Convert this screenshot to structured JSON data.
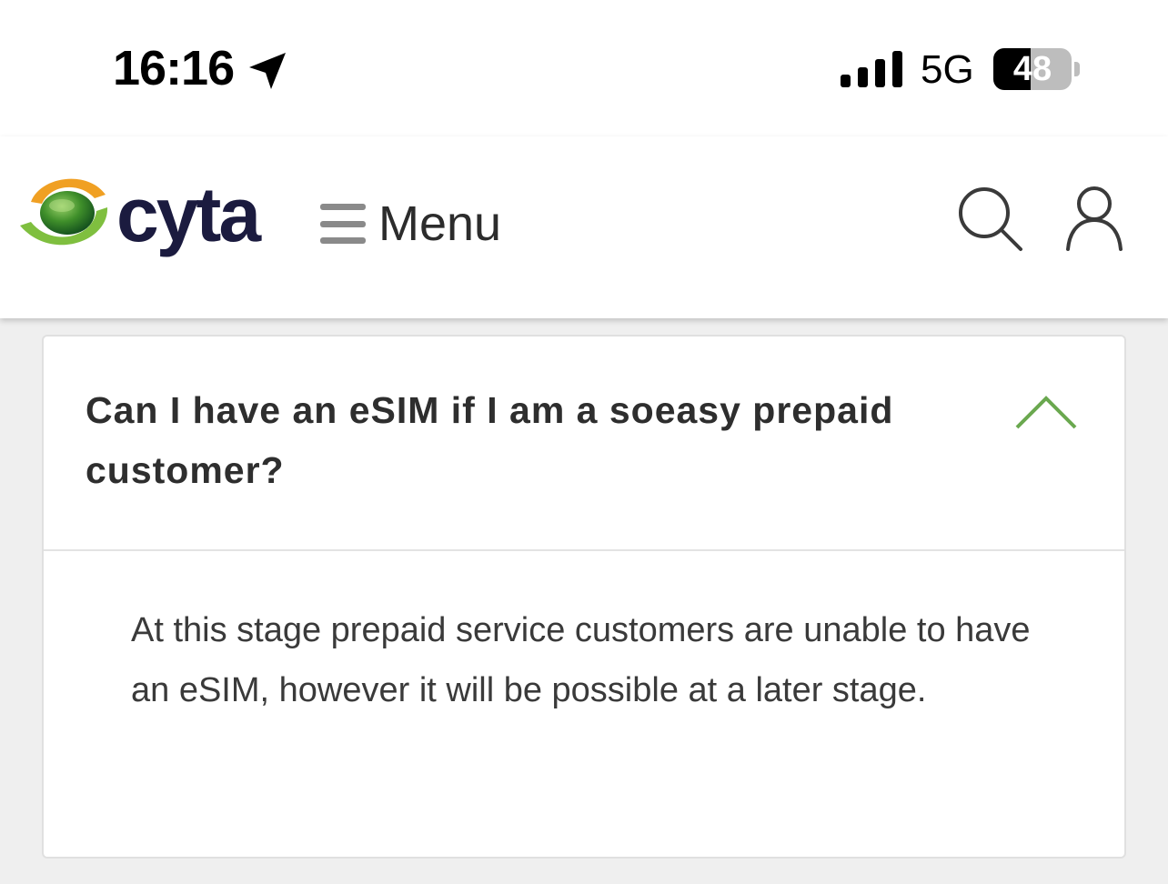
{
  "status_bar": {
    "time": "16:16",
    "network": "5G",
    "battery": "48",
    "battery_level": 0.48,
    "location_icon": "location-arrow-icon",
    "signal_icon": "cellular-signal-icon"
  },
  "header": {
    "logo_text": "cyta",
    "menu_label": "Menu",
    "menu_icon": "hamburger-icon",
    "search_icon": "search-icon",
    "user_icon": "user-icon"
  },
  "faq": {
    "question": "Can I have an eSIM if I am a soeasy prepaid customer?",
    "answer": "At this stage prepaid service customers are unable to have an eSIM, however it will be possible at a later stage.",
    "expanded": true,
    "chevron_icon": "chevron-up-icon"
  },
  "colors": {
    "brand_green": "#5a9a3c",
    "brand_orange": "#f0a023",
    "brand_navy": "#1b1b3f",
    "chevron_green": "#6aa84f",
    "page_background": "#efefef"
  }
}
